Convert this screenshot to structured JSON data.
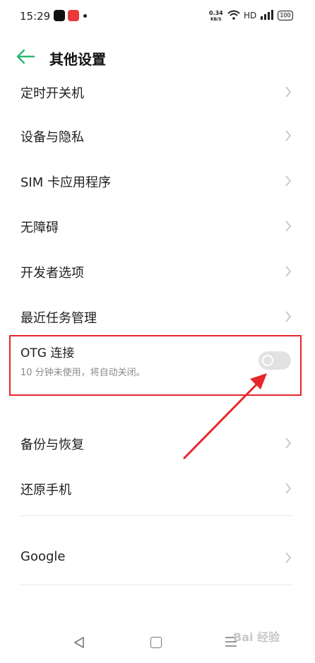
{
  "status_bar": {
    "time": "15:29",
    "net_speed_value": "0.34",
    "net_speed_unit": "KB/S",
    "hd": "HD",
    "battery": "100"
  },
  "header": {
    "title": "其他设置"
  },
  "settings": {
    "item_partial": "定时开关机",
    "item_device_privacy": "设备与隐私",
    "item_sim_apps": "SIM 卡应用程序",
    "item_accessibility": "无障碍",
    "item_developer": "开发者选项",
    "item_recent_tasks": "最近任务管理",
    "otg_title": "OTG 连接",
    "otg_subtitle": "10 分钟未使用，将自动关闭。",
    "otg_enabled": false,
    "item_backup": "备份与恢复",
    "item_reset": "还原手机",
    "item_google": "Google"
  },
  "colors": {
    "accent": "#2bb673",
    "annotation": "#e8262b"
  },
  "watermark": "Bai 经验"
}
